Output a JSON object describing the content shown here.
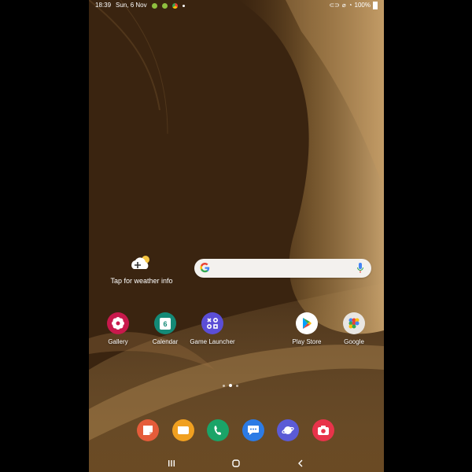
{
  "status_bar": {
    "time": "18:39",
    "date": "Sun, 6 Nov",
    "battery": "100%",
    "icons_left": [
      "android-icon",
      "android-icon",
      "chrome-icon",
      "dot-icon"
    ],
    "icons_right": [
      "link-icon",
      "mute-icon",
      "wifi-icon",
      "battery-icon"
    ]
  },
  "weather_widget": {
    "label": "Tap for weather info",
    "icon": "weather-add-icon"
  },
  "search_bar": {
    "logo": "google-g-icon",
    "mic": "mic-icon"
  },
  "home_apps": [
    {
      "label": "Gallery",
      "icon": "gallery-icon",
      "color": "#c8194c"
    },
    {
      "label": "Calendar",
      "icon": "calendar-icon",
      "color": "#148a77",
      "badge": "6"
    },
    {
      "label": "Game Launcher",
      "icon": "game-launcher-icon",
      "color": "#5b4ed6"
    },
    {
      "label": "Play Store",
      "icon": "play-store-icon",
      "color": "#ffffff"
    },
    {
      "label": "Google",
      "icon": "google-folder-icon",
      "color": "#e9e6e2"
    }
  ],
  "page_indicator": {
    "pages": 3,
    "current": 2
  },
  "dock": [
    {
      "name": "samsung-notes",
      "icon": "notes-icon",
      "color": "#e55c3a"
    },
    {
      "name": "my-files",
      "icon": "folder-icon",
      "color": "#f0a020"
    },
    {
      "name": "phone",
      "icon": "phone-icon",
      "color": "#1aa468"
    },
    {
      "name": "messages",
      "icon": "messages-icon",
      "color": "#2c7be5"
    },
    {
      "name": "internet",
      "icon": "internet-icon",
      "color": "#5b5bd6"
    },
    {
      "name": "camera",
      "icon": "camera-icon",
      "color": "#e8334a"
    }
  ],
  "nav_bar": {
    "recents": "recents-icon",
    "home": "home-icon",
    "back": "back-icon"
  }
}
